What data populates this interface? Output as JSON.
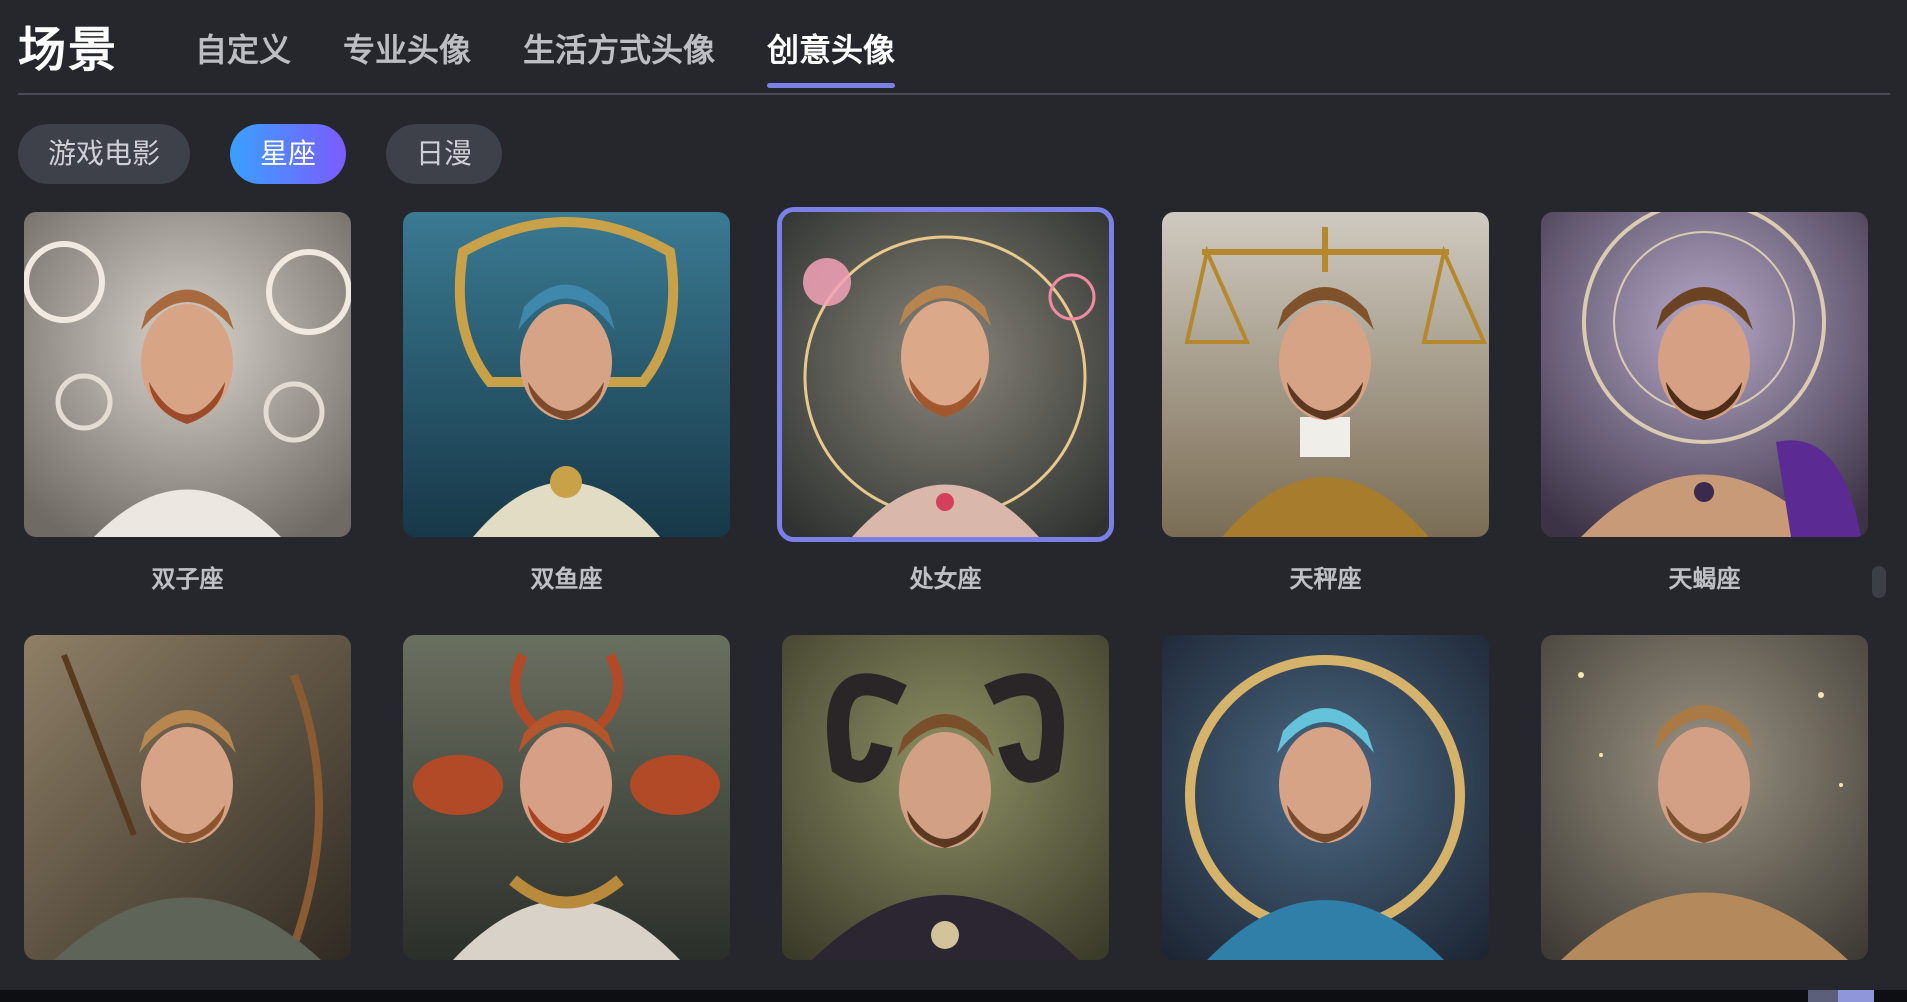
{
  "header": {
    "title": "场景",
    "tabs": [
      {
        "label": "自定义"
      },
      {
        "label": "专业头像"
      },
      {
        "label": "生活方式头像"
      },
      {
        "label": "创意头像"
      }
    ],
    "active_tab": "创意头像"
  },
  "filters": {
    "pills": [
      {
        "label": "游戏电影"
      },
      {
        "label": "星座"
      },
      {
        "label": "日漫"
      }
    ],
    "active": "星座"
  },
  "grid": {
    "row1": [
      {
        "label": "双子座",
        "theme": "silver-ornate"
      },
      {
        "label": "双鱼座",
        "theme": "gold-blue-water"
      },
      {
        "label": "处女座",
        "theme": "pink-halo-virgo",
        "selected": true
      },
      {
        "label": "天秤座",
        "theme": "gold-scales"
      },
      {
        "label": "天蝎座",
        "theme": "purple-tattoo-clock"
      }
    ],
    "row2": [
      {
        "label": "",
        "theme": "archer-bow"
      },
      {
        "label": "",
        "theme": "red-crabs"
      },
      {
        "label": "",
        "theme": "ram-horns"
      },
      {
        "label": "",
        "theme": "blue-star-ring"
      },
      {
        "label": "",
        "theme": "warm-fur-sparkles"
      }
    ]
  },
  "colors": {
    "accent": "#7b80e6",
    "pill_gradient_start": "#3aa0ff",
    "pill_gradient_end": "#7b5cff",
    "background": "#25272d"
  }
}
